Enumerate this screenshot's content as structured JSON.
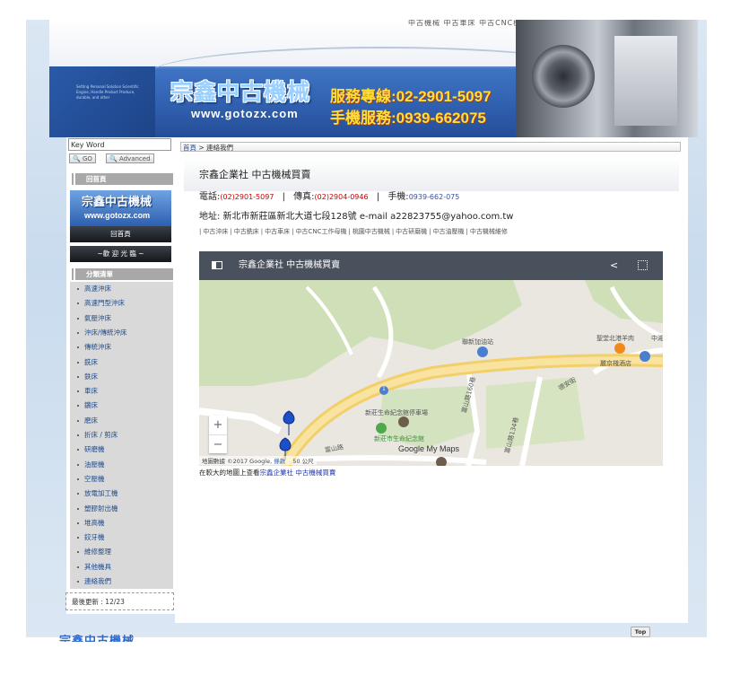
{
  "header": {
    "top_nav": "中古機械 中古車床 中古CNC機械 沖床 折床",
    "brand": "宗鑫中古機械",
    "url": "www.gotozx.com",
    "phone_label": "服務專線:02-2901-5097",
    "mobile_label": "手機服務:0939-662075",
    "tiny_text": "Setting Personal Solution Scientific Engine, Handle Product Produce, durable, and other"
  },
  "sidebar": {
    "search_placeholder": "Key Word",
    "go_label": "GO",
    "advanced_label": "Advanced",
    "home_head": "回首頁",
    "home_banner_title": "宗鑫中古機械",
    "home_banner_url": "www.gotozx.com",
    "home_link": "回首頁",
    "welcome": "~歡 迎 光 臨 ~",
    "category_head": "分類清單",
    "categories": [
      "高速沖床",
      "高速門型沖床",
      "氣壓沖床",
      "沖床/傳統沖床",
      "傳統沖床",
      "銑床",
      "鉄床",
      "車床",
      "鑽床",
      "磨床",
      "折床 / 剪床",
      "研磨機",
      "油壓機",
      "空壓機",
      "放電加工機",
      "塑膠射出機",
      "堆高機",
      "鉸牙機",
      "維修整理",
      "其他機具",
      "連絡我們"
    ],
    "last_update": "最後更新 : 12/23"
  },
  "main": {
    "breadcrumb_home": "首頁",
    "breadcrumb_current": " > 連絡我們",
    "company": "宗鑫企業社 中古機械買賣",
    "tel_label": "電話:",
    "tel": "(02)2901-5097",
    "fax_label": "傳真:",
    "fax": "(02)2904-0946",
    "mobile_label": "手機:",
    "mobile": "0939-662-075",
    "address": "地址: 新北市新莊區新北大道七段128號 e-mail a22823755@yahoo.com.tw",
    "links": [
      "中古沖床",
      "中古銑床",
      "中古車床",
      "中古CNC工作母機",
      "桃園中古機械",
      "中古研磨機",
      "中古油壓機",
      "中古機械維修"
    ],
    "map": {
      "title": "宗鑫企業社 中古機械買賣",
      "labels": {
        "gas": "聯新加油站",
        "restaurant": "聖堂北港羊肉",
        "hotel": "麗京棧酒店",
        "parking": "新莊生命紀念館停車場",
        "memorial": "新莊市生命紀念館",
        "road1": "德安街",
        "road2": "富山路160巷",
        "road3": "富山路134巷",
        "road4": "富山路",
        "highway": "1",
        "corner": "中湘"
      },
      "footer": "地圖數據 ©2017 Google,",
      "terms": "條款",
      "scale": "50 公尺",
      "google": "Google My Maps"
    },
    "caption_prefix": "在較大的地圖上查看",
    "caption_link": "宗鑫企業社 中古機械買賣"
  },
  "footer": {
    "top_label": "Top",
    "peek": "宗鑫中古機械"
  },
  "colors": {
    "accent": "#1c55b6",
    "phone": "#ffde3a",
    "red": "#cc0000"
  }
}
